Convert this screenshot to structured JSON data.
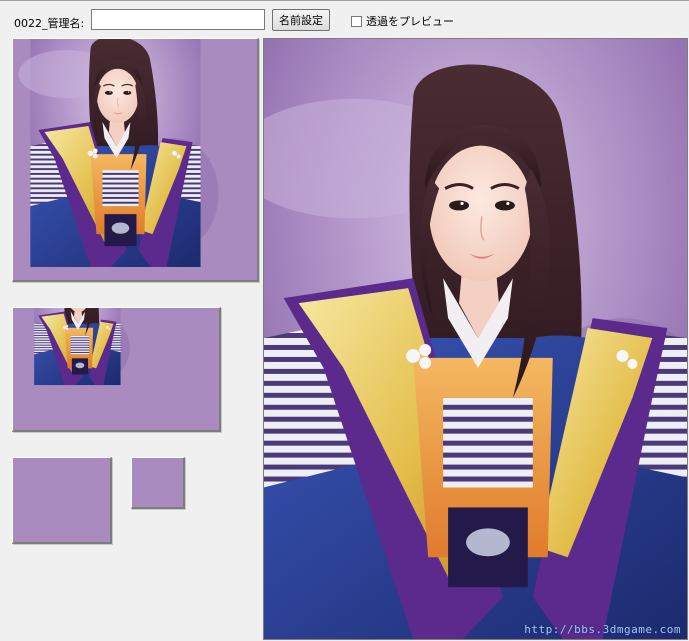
{
  "toolbar": {
    "name_label": "0022_管理名:",
    "name_value": "",
    "set_button_label": "名前設定",
    "preview_checkbox_label": "透過をプレビュー",
    "preview_checked": false
  },
  "portrait": {
    "watermark": "http://bbs.3dmgame.com"
  },
  "icons": {
    "checkbox": "checkbox-icon"
  },
  "colors": {
    "window_bg": "#f0f0f0",
    "portrait_bg": "#a98bc0",
    "hair": "#3b2126",
    "collar_gold": "#e9c95a",
    "armor_purple": "#5b2a8c",
    "armor_blue": "#2b3a8f"
  }
}
